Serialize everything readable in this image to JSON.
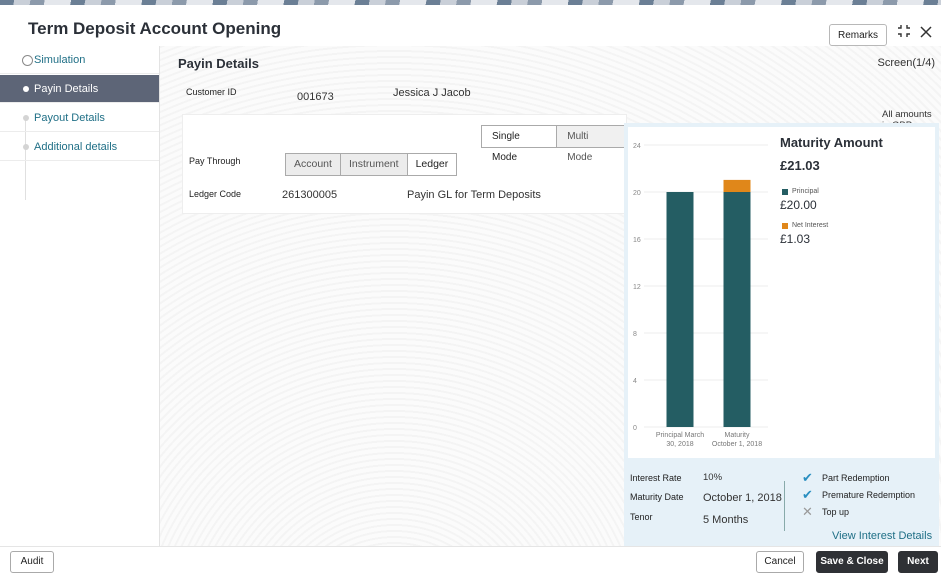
{
  "header": {
    "title": "Term Deposit Account Opening",
    "remarks_label": "Remarks"
  },
  "sidebar": {
    "items": [
      {
        "label": "Simulation"
      },
      {
        "label": "Payin Details"
      },
      {
        "label": "Payout Details"
      },
      {
        "label": "Additional details"
      }
    ]
  },
  "main": {
    "page_title": "Payin Details",
    "screen_indicator": "Screen(1/4)",
    "customer": {
      "label": "Customer ID",
      "id": "001673",
      "name": "Jessica J Jacob"
    },
    "mode": {
      "options": [
        "Single Mode",
        "Multi Mode"
      ],
      "selected": "Single Mode"
    },
    "pay_through": {
      "label": "Pay Through",
      "options": [
        "Account",
        "Instrument",
        "Ledger"
      ],
      "selected": "Ledger"
    },
    "ledger": {
      "label": "Ledger Code",
      "code": "261300005",
      "description": "Payin GL for Term Deposits"
    }
  },
  "summary": {
    "amounts_note": "All amounts in GBP",
    "maturity_title": "Maturity Amount",
    "maturity_value": "£21.03",
    "legend": [
      {
        "label": "Principal",
        "amount": "£20.00",
        "color": "#245d63"
      },
      {
        "label": "Net Interest",
        "amount": "£1.03",
        "color": "#e0871a"
      }
    ],
    "details": [
      {
        "label": "Interest Rate",
        "value": "10%"
      },
      {
        "label": "Maturity Date",
        "value": "October 1, 2018"
      },
      {
        "label": "Tenor",
        "value": "5 Months"
      }
    ],
    "features": [
      {
        "label": "Part Redemption",
        "icon": "check-icon",
        "enabled": true
      },
      {
        "label": "Premature Redemption",
        "icon": "check-icon",
        "enabled": true
      },
      {
        "label": "Top up",
        "icon": "cross-icon",
        "enabled": false
      }
    ],
    "view_link": "View Interest Details"
  },
  "chart_data": {
    "type": "bar",
    "categories": [
      "Principal March 30, 2018",
      "Maturity October 1, 2018"
    ],
    "category_lines": [
      [
        "Principal March",
        "30, 2018"
      ],
      [
        "Maturity",
        "October 1, 2018"
      ]
    ],
    "series": [
      {
        "name": "Principal",
        "values": [
          20,
          20
        ],
        "color": "#245d63"
      },
      {
        "name": "Net Interest",
        "values": [
          0,
          1.03
        ],
        "color": "#e0871a"
      }
    ],
    "stacked": true,
    "ylim": [
      0,
      24
    ],
    "yticks": [
      0,
      4,
      8,
      12,
      16,
      20,
      24
    ],
    "grid": true
  },
  "footer": {
    "audit_label": "Audit",
    "cancel_label": "Cancel",
    "save_close_label": "Save & Close",
    "next_label": "Next"
  }
}
